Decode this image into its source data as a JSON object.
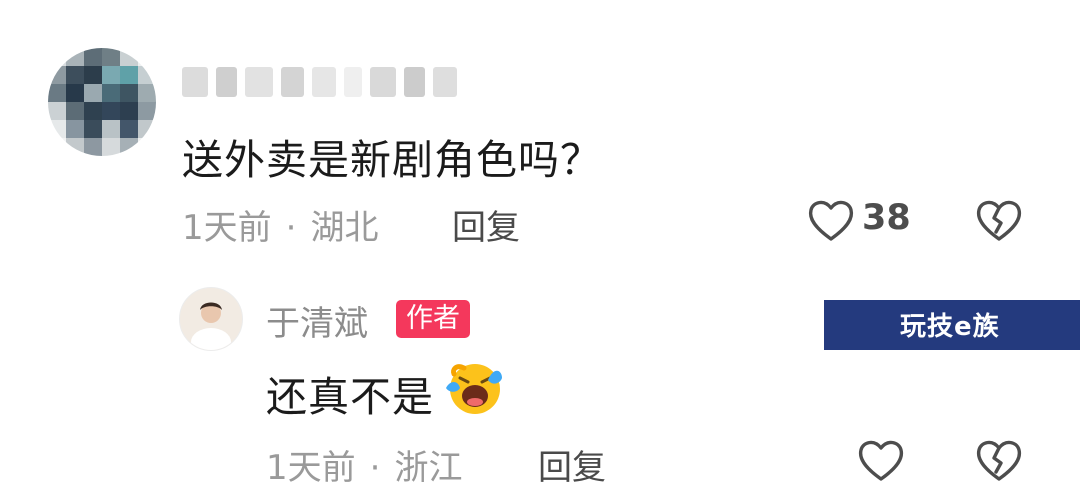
{
  "comment": {
    "text": "送外卖是新剧角色吗？",
    "time": "1天前",
    "location": "湖北",
    "separator": "·",
    "reply_label": "回复",
    "like_count": "38",
    "like_icon": "heart-outline-icon",
    "dislike_icon": "broken-heart-icon"
  },
  "reply": {
    "author_name": "于清斌",
    "author_badge": "作者",
    "text": "还真不是",
    "emoji": "laughing-crying-emoji",
    "time": "1天前",
    "location": "浙江",
    "separator": "·",
    "reply_label": "回复",
    "like_icon": "heart-outline-icon",
    "dislike_icon": "broken-heart-icon"
  },
  "watermark": {
    "text": "玩技e族"
  },
  "colors": {
    "badge": "#f4385c",
    "meta_text": "#9a9a9a",
    "watermark_bg": "#243a7e"
  }
}
